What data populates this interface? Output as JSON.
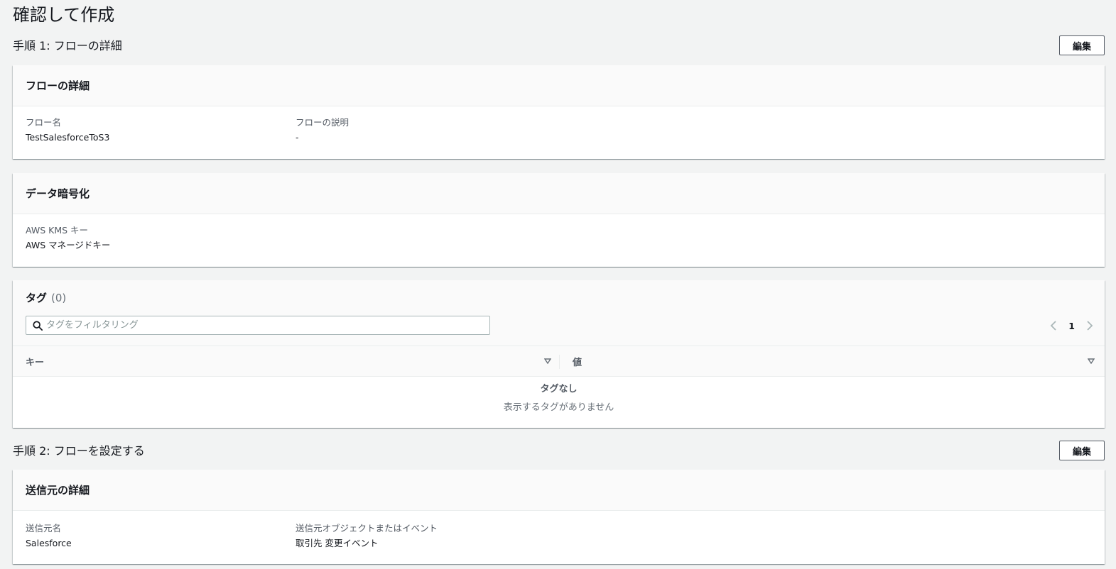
{
  "page": {
    "title": "確認して作成"
  },
  "step1": {
    "title": "手順 1: フローの詳細",
    "edit_label": "編集",
    "flow_details": {
      "header": "フローの詳細",
      "name_label": "フロー名",
      "name_value": "TestSalesforceToS3",
      "desc_label": "フローの説明",
      "desc_value": "-"
    },
    "encryption": {
      "header": "データ暗号化",
      "kms_label": "AWS KMS キー",
      "kms_value": "AWS マネージドキー"
    },
    "tags": {
      "title": "タグ",
      "count": "(0)",
      "search_placeholder": "タグをフィルタリング",
      "page_number": "1",
      "columns": [
        "キー",
        "値"
      ],
      "empty_title": "タグなし",
      "empty_desc": "表示するタグがありません"
    }
  },
  "step2": {
    "title": "手順 2: フローを設定する",
    "edit_label": "編集",
    "source_details": {
      "header": "送信元の詳細",
      "source_name_label": "送信元名",
      "source_name_value": "Salesforce",
      "source_object_label": "送信元オブジェクトまたはイベント",
      "source_object_value": "取引先 変更イベント"
    }
  },
  "icons": {
    "search": "search-icon",
    "sort": "caret-down-icon",
    "prev": "chevron-left-icon",
    "next": "chevron-right-icon"
  }
}
